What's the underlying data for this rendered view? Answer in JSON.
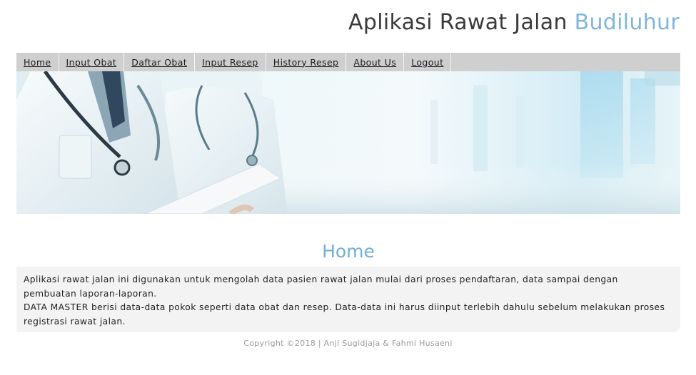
{
  "header": {
    "title_main": "Aplikasi Rawat Jalan",
    "title_accent": "Budiluhur",
    "accent_color": "#7fb6d9"
  },
  "nav": {
    "items": [
      {
        "label": "Home"
      },
      {
        "label": "Input Obat"
      },
      {
        "label": "Daftar Obat"
      },
      {
        "label": "Input Resep"
      },
      {
        "label": "History Resep"
      },
      {
        "label": "About Us"
      },
      {
        "label": "Logout"
      }
    ]
  },
  "banner": {
    "image": "doctors-banner"
  },
  "content": {
    "title": "Home",
    "paragraph1": "Aplikasi rawat jalan ini digunakan untuk mengolah data pasien rawat jalan mulai dari proses pendaftaran, data sampai dengan pembuatan laporan-laporan.",
    "paragraph2": "DATA MASTER berisi data-data pokok seperti data obat dan resep. Data-data ini harus diinput terlebih dahulu sebelum melakukan proses registrasi rawat jalan."
  },
  "footer": {
    "text": "Copyright ©2018 | Anji Sugidjaja & Fahmi Husaeni"
  }
}
